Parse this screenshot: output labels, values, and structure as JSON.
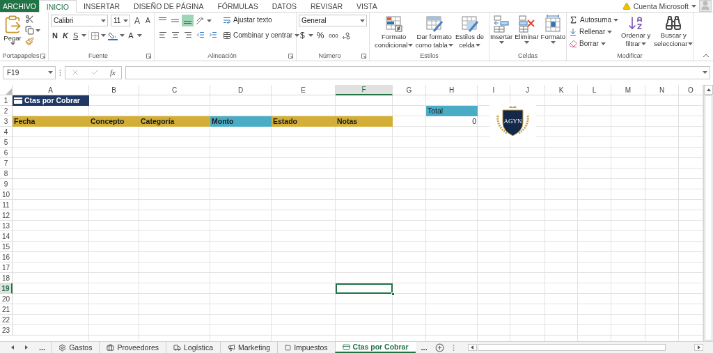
{
  "menu_tabs": [
    {
      "label": "ARCHIVO",
      "kind": "file",
      "selected": false
    },
    {
      "label": "INICIO",
      "kind": "tab",
      "selected": true
    },
    {
      "label": "INSERTAR",
      "kind": "tab",
      "selected": false
    },
    {
      "label": "DISEÑO DE PÁGINA",
      "kind": "tab",
      "selected": false
    },
    {
      "label": "FÓRMULAS",
      "kind": "tab",
      "selected": false
    },
    {
      "label": "DATOS",
      "kind": "tab",
      "selected": false
    },
    {
      "label": "REVISAR",
      "kind": "tab",
      "selected": false
    },
    {
      "label": "VISTA",
      "kind": "tab",
      "selected": false
    }
  ],
  "account": {
    "label": "Cuenta Microsoft"
  },
  "clipboard": {
    "title": "Portapapeles",
    "paste": "Pegar"
  },
  "font": {
    "title": "Fuente",
    "name": "Calibri",
    "size": "11",
    "grow": "A",
    "shrink": "A",
    "bold": "N",
    "italic": "K",
    "underline": "S",
    "tint_letter": "A"
  },
  "alignment": {
    "title": "Alineación",
    "vertical": [
      {
        "selected": false
      },
      {
        "selected": false
      },
      {
        "selected": true
      }
    ],
    "wrap": "Ajustar texto",
    "merge": "Combinar y centrar"
  },
  "number": {
    "title": "Número",
    "format": "General",
    "currency": "$",
    "percent": "%",
    "thousands": "000"
  },
  "styles": {
    "title": "Estilos",
    "buttons": [
      {
        "lines": [
          "Formato",
          "condicional"
        ]
      },
      {
        "lines": [
          "Dar formato",
          "como tabla"
        ]
      },
      {
        "lines": [
          "Estilos de",
          "celda"
        ]
      }
    ]
  },
  "cells": {
    "title": "Celdas",
    "buttons": [
      {
        "lines": [
          "Insertar"
        ]
      },
      {
        "lines": [
          "Eliminar"
        ]
      },
      {
        "lines": [
          "Formato"
        ]
      }
    ]
  },
  "editing": {
    "title": "Modificar",
    "small": [
      "Autosuma",
      "Rellenar",
      "Borrar"
    ],
    "large": [
      {
        "lines": [
          "Ordenar y",
          "filtrar"
        ]
      },
      {
        "lines": [
          "Buscar y",
          "seleccionar"
        ]
      }
    ]
  },
  "formula_bar": {
    "name_box": "F19",
    "fx": "fx"
  },
  "sheet": {
    "columns": [
      {
        "label": "A",
        "selected": false
      },
      {
        "label": "B",
        "selected": false
      },
      {
        "label": "C",
        "selected": false
      },
      {
        "label": "D",
        "selected": false
      },
      {
        "label": "E",
        "selected": false
      },
      {
        "label": "F",
        "selected": true
      },
      {
        "label": "G",
        "selected": false
      },
      {
        "label": "H",
        "selected": false
      },
      {
        "label": "I",
        "selected": false
      },
      {
        "label": "J",
        "selected": false
      },
      {
        "label": "K",
        "selected": false
      },
      {
        "label": "L",
        "selected": false
      },
      {
        "label": "M",
        "selected": false
      },
      {
        "label": "N",
        "selected": false
      },
      {
        "label": "O",
        "selected": false
      }
    ],
    "rows": [
      {
        "label": "1",
        "selected": false,
        "cells": [
          {
            "text": "Ctas por Cobrar",
            "kind": "title"
          }
        ]
      },
      {
        "label": "2",
        "selected": false,
        "cells": [
          null,
          null,
          null,
          null,
          null,
          null,
          null,
          {
            "text": "Total",
            "kind": "accent"
          }
        ]
      },
      {
        "label": "3",
        "selected": false,
        "cells": [
          {
            "text": "Fecha",
            "kind": "header"
          },
          {
            "text": "Concepto",
            "kind": "header"
          },
          {
            "text": "Categoría",
            "kind": "header"
          },
          {
            "text": "Monto",
            "kind": "accent_header"
          },
          {
            "text": "Estado",
            "kind": "header"
          },
          {
            "text": "Notas",
            "kind": "header"
          },
          null,
          {
            "text": "0",
            "kind": "number"
          }
        ]
      },
      {
        "label": "4",
        "selected": false
      },
      {
        "label": "5",
        "selected": false
      },
      {
        "label": "6",
        "selected": false
      },
      {
        "label": "7",
        "selected": false
      },
      {
        "label": "8",
        "selected": false
      },
      {
        "label": "9",
        "selected": false
      },
      {
        "label": "10",
        "selected": false
      },
      {
        "label": "11",
        "selected": false
      },
      {
        "label": "12",
        "selected": false
      },
      {
        "label": "13",
        "selected": false
      },
      {
        "label": "14",
        "selected": false
      },
      {
        "label": "15",
        "selected": false
      },
      {
        "label": "16",
        "selected": false
      },
      {
        "label": "17",
        "selected": false
      },
      {
        "label": "18",
        "selected": false
      },
      {
        "label": "19",
        "selected": true
      },
      {
        "label": "20",
        "selected": false
      },
      {
        "label": "21",
        "selected": false
      },
      {
        "label": "22",
        "selected": false
      },
      {
        "label": "23",
        "selected": false
      }
    ]
  },
  "logo": {
    "text": "AGYN"
  },
  "sheet_tabs": {
    "more_left": "...",
    "more_right": "...",
    "tabs": [
      {
        "label": "Gastos",
        "selected": false
      },
      {
        "label": "Proveedores",
        "selected": false
      },
      {
        "label": "Logística",
        "selected": false
      },
      {
        "label": "Marketing",
        "selected": false
      },
      {
        "label": "Impuestos",
        "selected": false
      },
      {
        "label": "Ctas por Cobrar",
        "selected": true
      }
    ]
  }
}
